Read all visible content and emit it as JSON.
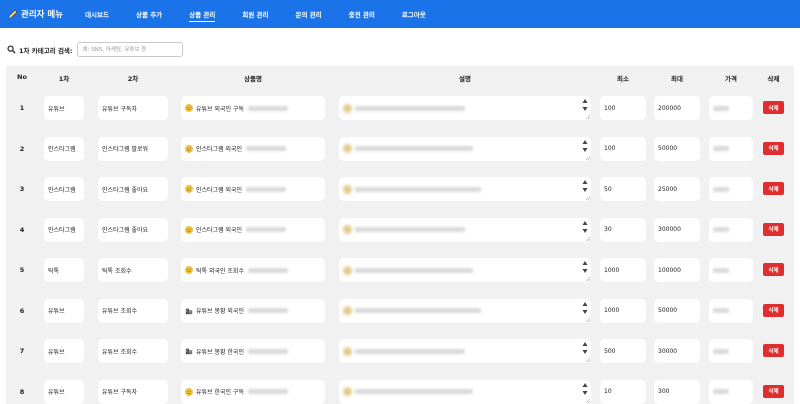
{
  "header": {
    "title": "관리자 메뉴",
    "nav": [
      {
        "label": "대시보드",
        "active": false
      },
      {
        "label": "상품 추가",
        "active": false
      },
      {
        "label": "상품 관리",
        "active": true
      },
      {
        "label": "회원 관리",
        "active": false
      },
      {
        "label": "문의 관리",
        "active": false
      },
      {
        "label": "충전 관리",
        "active": false
      },
      {
        "label": "로그아웃",
        "active": false
      }
    ]
  },
  "search": {
    "label": "1차 카테고리 검색:",
    "placeholder": "예: SNS, 마케팅, 유튜브 등"
  },
  "table": {
    "columns": [
      "No",
      "1차",
      "2차",
      "상품명",
      "설명",
      "최소",
      "최대",
      "가격",
      "삭제"
    ],
    "delete_label": "삭제",
    "rows": [
      {
        "no": "1",
        "cat1": "유튜브",
        "cat2": "유튜브 구독자",
        "icon": "smiley-icon",
        "name": "유튜브 외국인 구독",
        "min": "100",
        "max": "200000"
      },
      {
        "no": "2",
        "cat1": "인스타그램",
        "cat2": "인스타그램 팔로워",
        "icon": "smiley-icon",
        "name": "인스타그램 외국인",
        "min": "100",
        "max": "50000"
      },
      {
        "no": "3",
        "cat1": "인스타그램",
        "cat2": "인스타그램 좋아요",
        "icon": "smiley-icon",
        "name": "인스타그램 외국인",
        "min": "50",
        "max": "25000"
      },
      {
        "no": "4",
        "cat1": "인스타그램",
        "cat2": "인스타그램 좋아요",
        "icon": "smiley-icon",
        "name": "인스타그램 외국인",
        "min": "30",
        "max": "300000"
      },
      {
        "no": "5",
        "cat1": "틱톡",
        "cat2": "틱톡 조회수",
        "icon": "smiley-icon",
        "name": "틱톡 외국인 조회수",
        "min": "1000",
        "max": "100000"
      },
      {
        "no": "6",
        "cat1": "유튜브",
        "cat2": "유튜브 조회수",
        "icon": "building-icon",
        "name": "유튜브 봉황 외국인",
        "min": "1000",
        "max": "50000"
      },
      {
        "no": "7",
        "cat1": "유튜브",
        "cat2": "유튜브 조회수",
        "icon": "building-icon",
        "name": "유튜브 봉황 한국인",
        "min": "500",
        "max": "30000"
      },
      {
        "no": "8",
        "cat1": "유튜브",
        "cat2": "유튜브 구독자",
        "icon": "smiley-icon",
        "name": "유튜브 한국인 구독",
        "min": "10",
        "max": "300"
      }
    ]
  },
  "colors": {
    "header_bg": "#1a73e8",
    "table_bg": "#f1f1f1",
    "delete_bg": "#e02d2d"
  }
}
